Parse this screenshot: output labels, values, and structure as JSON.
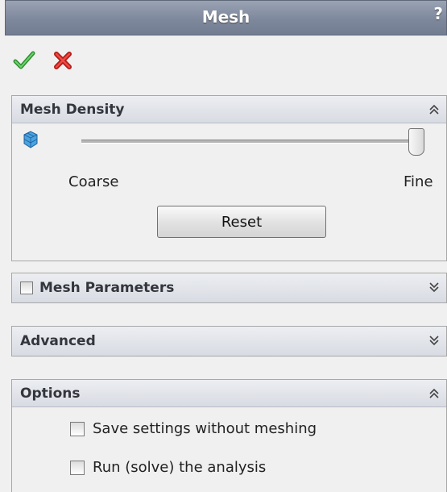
{
  "window": {
    "title": "Mesh",
    "help": "?"
  },
  "actions": {
    "ok_icon": "checkmark-icon",
    "cancel_icon": "close-icon",
    "ok_color": "#3aa63a",
    "cancel_color": "#d9231f"
  },
  "mesh_density": {
    "header": "Mesh Density",
    "icon": "mesh-density-icon",
    "slider": {
      "value": 1.0,
      "min_label": "Coarse",
      "max_label": "Fine"
    },
    "reset_label": "Reset"
  },
  "mesh_parameters": {
    "header": "Mesh Parameters",
    "checked": false
  },
  "advanced": {
    "header": "Advanced"
  },
  "options": {
    "header": "Options",
    "items": [
      {
        "label": "Save settings without meshing",
        "checked": false
      },
      {
        "label": "Run (solve) the analysis",
        "checked": false
      }
    ]
  }
}
